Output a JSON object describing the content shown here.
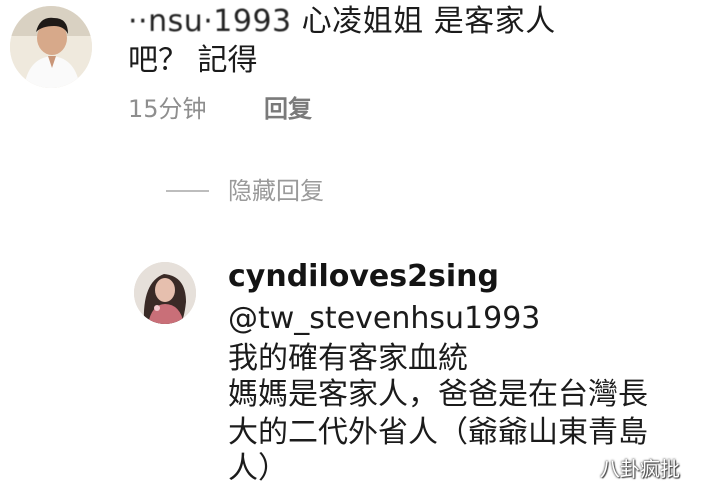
{
  "comment": {
    "username_partial": "··nsu·1993",
    "text_line1": " 心凌姐姐 是客家人",
    "text_line2": "吧？ 記得",
    "time": "15分钟",
    "reply_label": "回复"
  },
  "hidden_replies_label": "隐藏回复",
  "reply": {
    "username": "cyndiloves2sing",
    "mention": "@tw_stevenhsu1993",
    "lines": [
      "我的確有客家血統",
      "媽媽是客家人，爸爸是在台灣長",
      "大的二代外省人（爺爺山東青島",
      "人）"
    ]
  },
  "watermark": "八卦疯批",
  "colors": {
    "text": "#1b1b1b",
    "meta": "#8e8e8e",
    "divider": "#bdbdbd"
  }
}
